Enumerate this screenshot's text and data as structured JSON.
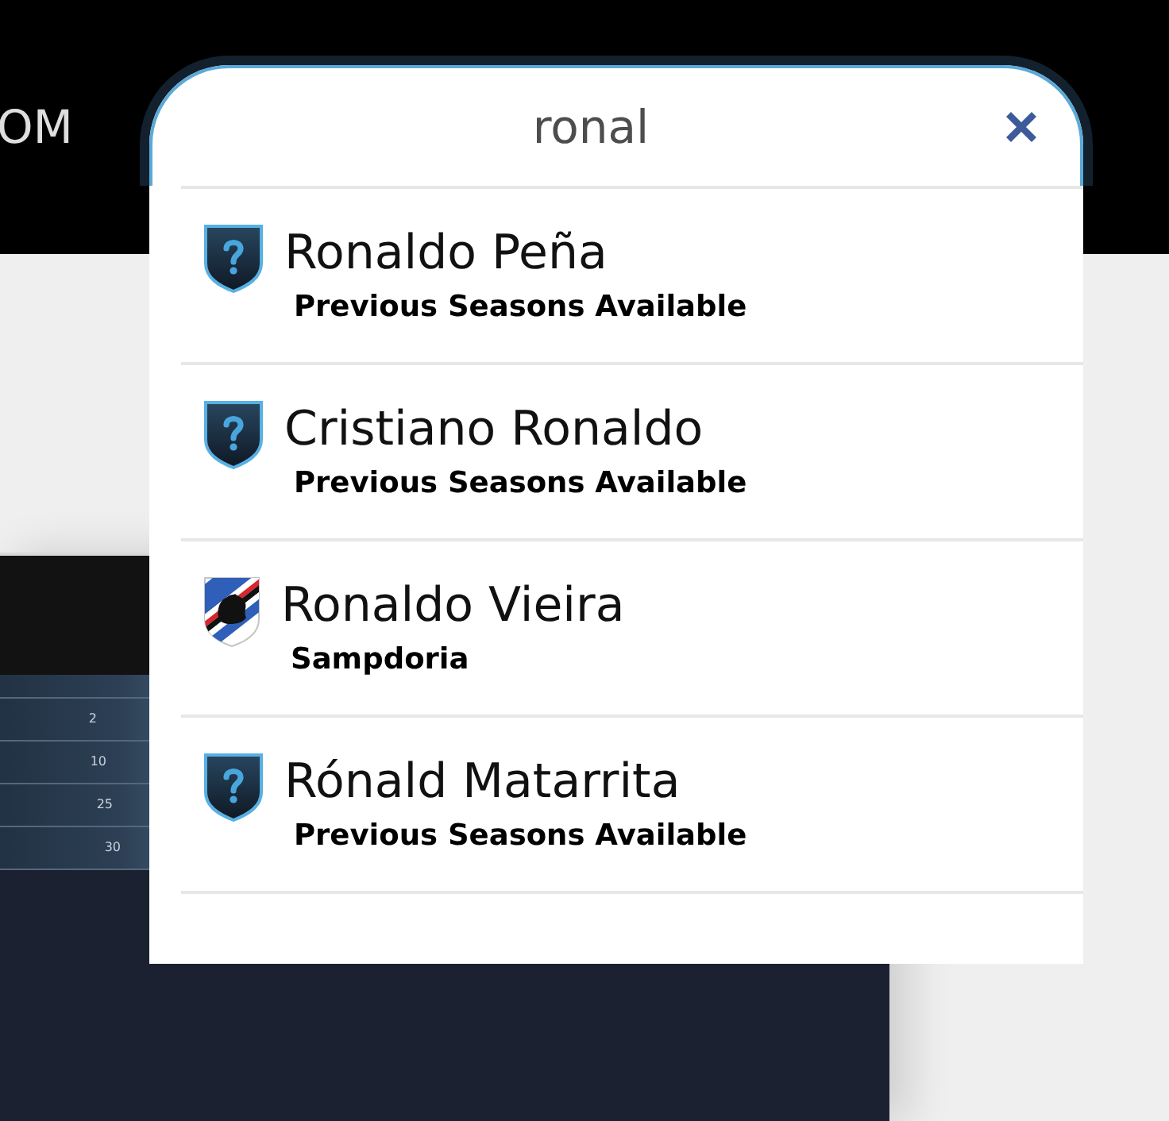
{
  "header": {
    "nav_text": "OM"
  },
  "background_app": {
    "table_values": [
      "2",
      "10",
      "25",
      "30"
    ]
  },
  "search": {
    "value": "ronal"
  },
  "results": [
    {
      "name": "Ronaldo Peña",
      "detail": "Previous Seasons Available",
      "kind": "unknown"
    },
    {
      "name": "Cristiano Ronaldo",
      "detail": "Previous Seasons Available",
      "kind": "unknown"
    },
    {
      "name": "Ronaldo Vieira",
      "detail": "Sampdoria",
      "kind": "club"
    },
    {
      "name": "Rónald Matarrita",
      "detail": "Previous Seasons Available",
      "kind": "unknown"
    }
  ]
}
